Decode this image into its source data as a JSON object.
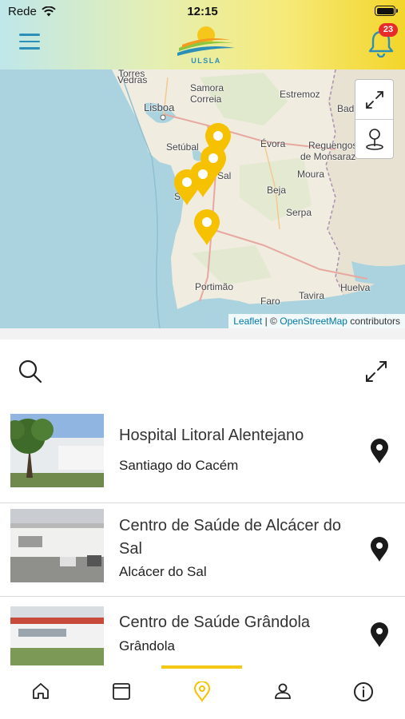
{
  "status_bar": {
    "carrier": "Rede",
    "time": "12:15"
  },
  "header": {
    "logo_text": "ULSLA",
    "notification_count": "23",
    "accent": "#2c8fb8"
  },
  "map": {
    "places": [
      {
        "id": "torres-vedras",
        "text": "Torres"
      },
      {
        "id": "vedras",
        "text": "Vedras"
      },
      {
        "id": "samora",
        "text": "Samora"
      },
      {
        "id": "correia",
        "text": "Correia"
      },
      {
        "id": "estremoz",
        "text": "Estremoz"
      },
      {
        "id": "badajoz",
        "text": "Bad"
      },
      {
        "id": "lisboa",
        "text": "Lisboa"
      },
      {
        "id": "setubal",
        "text": "Setúbal"
      },
      {
        "id": "evora",
        "text": "Évora"
      },
      {
        "id": "reguengos",
        "text": "Reguengos"
      },
      {
        "id": "monsaraz",
        "text": "de Monsaraz"
      },
      {
        "id": "sal",
        "text": "Sal"
      },
      {
        "id": "moura",
        "text": "Moura"
      },
      {
        "id": "sines",
        "text": "S"
      },
      {
        "id": "beja",
        "text": "Beja"
      },
      {
        "id": "serpa",
        "text": "Serpa"
      },
      {
        "id": "portimao",
        "text": "Portimão"
      },
      {
        "id": "huelva",
        "text": "Huelva"
      },
      {
        "id": "faro",
        "text": "Faro"
      },
      {
        "id": "tavira",
        "text": "Tavira"
      }
    ],
    "attribution": {
      "leaflet": "Leaflet",
      "sep": "| ©",
      "osm": "OpenStreetMap",
      "contributors": "contributors"
    },
    "marker_color": "#f6c200"
  },
  "list": {
    "items": [
      {
        "name": "Hospital Litoral Alentejano",
        "city": "Santiago do Cacém"
      },
      {
        "name": "Centro de Saúde de Alcácer do Sal",
        "city": "Alcácer do Sal"
      },
      {
        "name": "Centro de Saúde Grândola",
        "city": "Grândola"
      }
    ]
  },
  "tabbar": {
    "tabs": [
      {
        "icon": "home-icon"
      },
      {
        "icon": "calendar-icon"
      },
      {
        "icon": "location-icon",
        "active": true
      },
      {
        "icon": "user-icon"
      },
      {
        "icon": "info-icon"
      }
    ],
    "active_color": "#f6c816"
  }
}
